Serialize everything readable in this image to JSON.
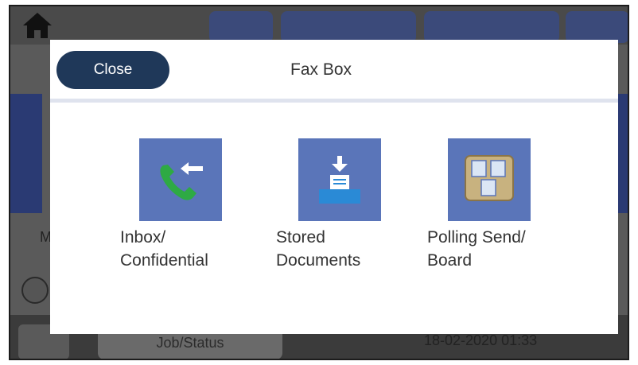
{
  "background": {
    "job_status_label": "Job/Status",
    "datetime": "18-02-2020 01:33",
    "partial_letter": "M"
  },
  "dialog": {
    "title": "Fax Box",
    "close_label": "Close",
    "tiles": [
      {
        "label": "Inbox/\nConfidential",
        "icon": "fax-inbox-icon"
      },
      {
        "label": "Stored\nDocuments",
        "icon": "stored-documents-icon"
      },
      {
        "label": "Polling Send/\nBoard",
        "icon": "polling-board-icon"
      }
    ]
  },
  "colors": {
    "close_button": "#1f3859",
    "tile_icon_bg": "#5a75b9",
    "phone_green": "#2eaa44",
    "tray_blue": "#2a8ad6",
    "board_tan": "#c8b27f"
  }
}
